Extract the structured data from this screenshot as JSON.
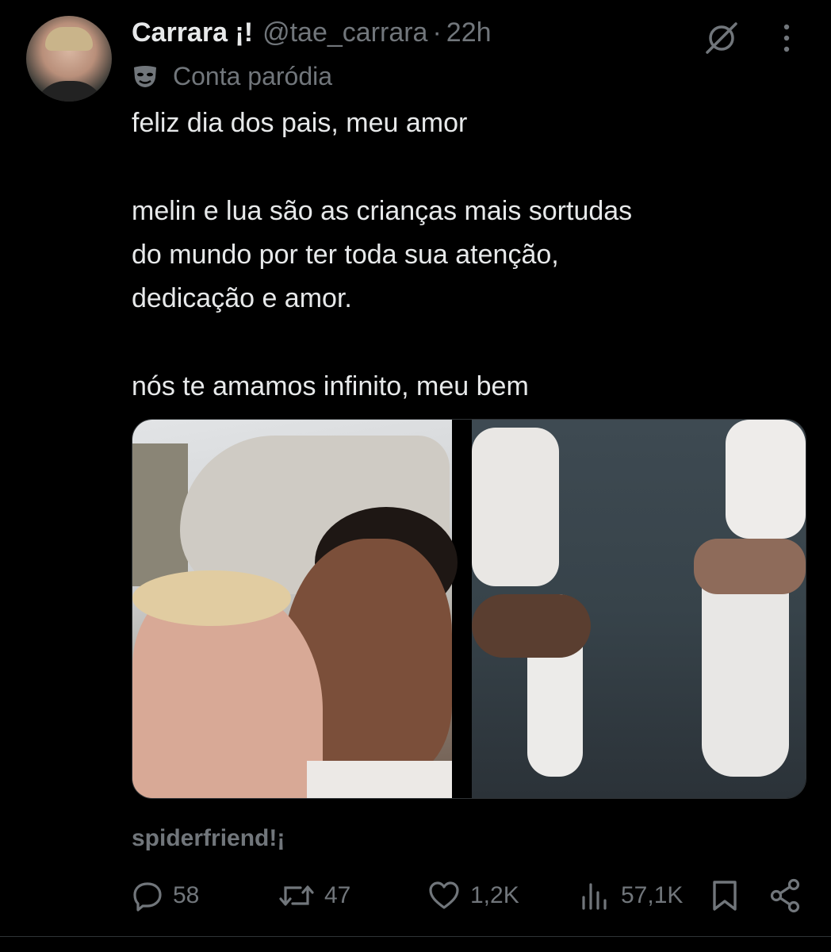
{
  "post": {
    "display_name": "Carrara ¡!",
    "handle": "@tae_carrara",
    "separator": "·",
    "time": "22h",
    "parody_label": "Conta paródia",
    "text_lines": [
      "feliz dia dos pais, meu amor",
      "melin e lua são as crianças mais sortudas",
      "do mundo por ter toda sua atenção,",
      "dedicação e amor.",
      "nós te amamos infinito, meu bem"
    ],
    "community_label": "spiderfriend!¡"
  },
  "actions": {
    "replies": "58",
    "reposts": "47",
    "likes": "1,2K",
    "views": "57,1K"
  },
  "icons": {
    "header_right": [
      "grok-icon",
      "more-icon"
    ],
    "parody": "mask-icon",
    "actions": [
      "reply-icon",
      "repost-icon",
      "like-icon",
      "views-icon",
      "bookmark-icon",
      "share-icon"
    ]
  },
  "colors": {
    "background": "#000000",
    "text_primary": "#e7e9ea",
    "text_secondary": "#71767b",
    "border": "#2f3336"
  }
}
